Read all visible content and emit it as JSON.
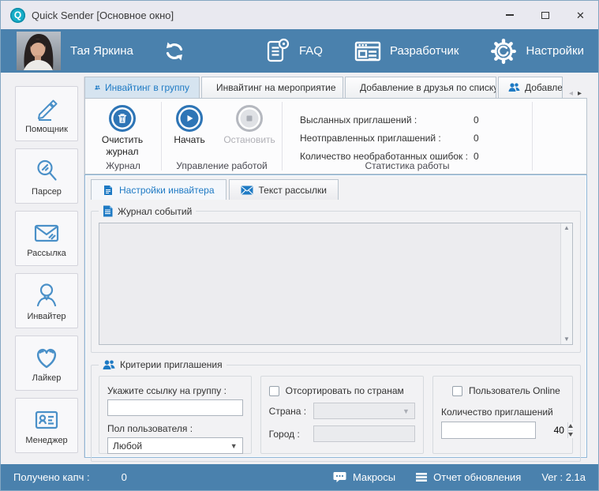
{
  "window": {
    "title": "Quick Sender [Основное окно]"
  },
  "header": {
    "user_name": "Тая Яркина",
    "faq_label": "FAQ",
    "developer_label": "Разработчик",
    "settings_label": "Настройки"
  },
  "sidebar": {
    "items": [
      {
        "label": "Помощник",
        "icon": "pencil-icon"
      },
      {
        "label": "Парсер",
        "icon": "magnifier-icon"
      },
      {
        "label": "Рассылка",
        "icon": "envelope-icon"
      },
      {
        "label": "Инвайтер",
        "icon": "person-icon"
      },
      {
        "label": "Лайкер",
        "icon": "heart-icon"
      },
      {
        "label": "Менеджер",
        "icon": "id-card-icon"
      }
    ]
  },
  "tabs": [
    {
      "label": "Инвайтинг в группу",
      "active": true
    },
    {
      "label": "Инвайтинг на мероприятие",
      "active": false
    },
    {
      "label": "Добавление в друзья по списку",
      "active": false
    },
    {
      "label": "Добавле",
      "active": false,
      "truncated": true
    }
  ],
  "ribbon": {
    "clear_log_label": "Очистить журнал",
    "start_label": "Начать",
    "stop_label": "Остановить",
    "group_log_title": "Журнал",
    "group_control_title": "Управление работой",
    "group_stats_title": "Статистика работы",
    "stats": [
      {
        "label": "Высланных приглашений :",
        "value": "0"
      },
      {
        "label": "Неотправленных приглашений :",
        "value": "0"
      },
      {
        "label": "Количество необработанных ошибок :",
        "value": "0"
      }
    ]
  },
  "subtabs": [
    {
      "label": "Настройки инвайтера",
      "active": true
    },
    {
      "label": "Текст рассылки",
      "active": false
    }
  ],
  "event_log": {
    "title": "Журнал событий",
    "content": ""
  },
  "criteria": {
    "title": "Критерии приглашения",
    "group_link_label": "Укажите ссылку на группу :",
    "group_link_value": "",
    "gender_label": "Пол пользователя :",
    "gender_value": "Любой",
    "sort_by_country_label": "Отсортировать по странам",
    "sort_by_country_checked": false,
    "country_label": "Страна :",
    "country_value": "",
    "city_label": "Город :",
    "city_value": "",
    "online_label": "Пользователь Online",
    "online_checked": false,
    "invites_count_label": "Количество приглашений",
    "invites_count_value": "40"
  },
  "statusbar": {
    "captcha_label": "Получено капч :",
    "captcha_value": "0",
    "macros_label": "Макросы",
    "update_report_label": "Отчет обновления",
    "version": "Ver : 2.1a"
  },
  "colors": {
    "header_blue": "#4a81ad",
    "accent_blue": "#2e75b6",
    "active_tab_text": "#1e7ac4",
    "sidebar_icon_blue": "#4a90c8",
    "logo_teal": "#17aec8"
  }
}
